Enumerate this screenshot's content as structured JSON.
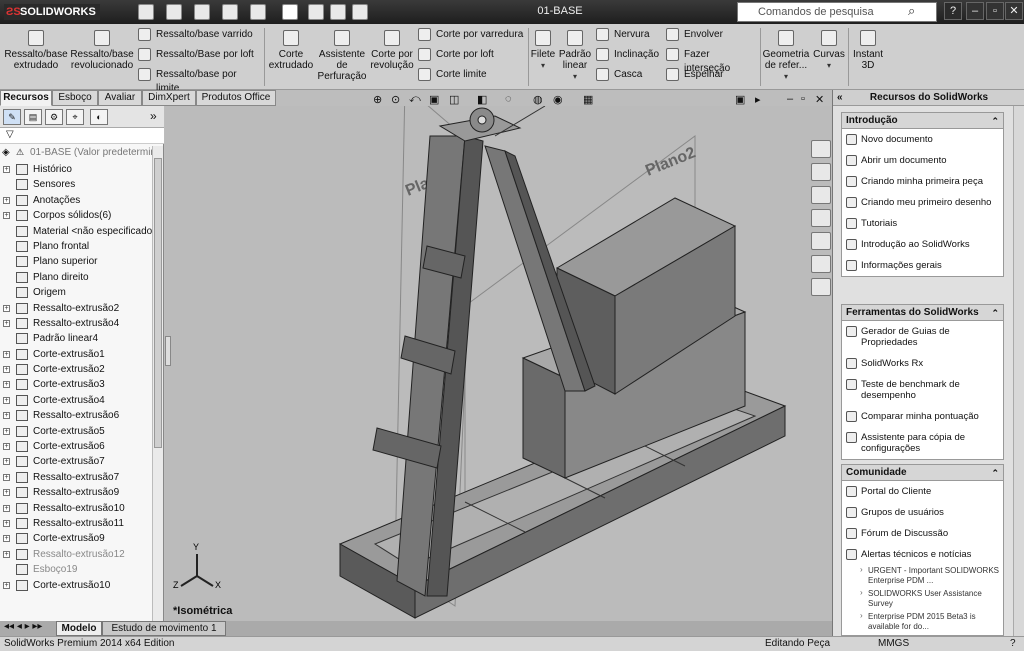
{
  "app": {
    "logo": "SOLIDWORKS",
    "doc_title": "01-BASE"
  },
  "search": {
    "placeholder": "Comandos de pesquisa"
  },
  "window": {
    "minimize": "–",
    "maximize": "▫",
    "close": "✕",
    "help": "?"
  },
  "ribbon": {
    "big": [
      {
        "label": "Ressalto/base extrudado"
      },
      {
        "label": "Ressalto/base revolucionado"
      },
      {
        "label": "Corte extrudado"
      },
      {
        "label": "Assistente de Perfuração"
      },
      {
        "label": "Corte por revolução"
      },
      {
        "label": "Filete"
      },
      {
        "label": "Padrão linear"
      },
      {
        "label": "Geometria de refer..."
      },
      {
        "label": "Curvas"
      },
      {
        "label": "Instant 3D"
      }
    ],
    "small": [
      {
        "label": "Ressalto/base varrido"
      },
      {
        "label": "Ressalto/Base por loft"
      },
      {
        "label": "Ressalto/base por limite"
      },
      {
        "label": "Corte por varredura"
      },
      {
        "label": "Corte por loft"
      },
      {
        "label": "Corte limite"
      },
      {
        "label": "Nervura"
      },
      {
        "label": "Inclinação"
      },
      {
        "label": "Casca"
      },
      {
        "label": "Envolver"
      },
      {
        "label": "Fazer interseção"
      },
      {
        "label": "Espelhar"
      }
    ]
  },
  "tabs": [
    "Recursos",
    "Esboço",
    "Avaliar",
    "DimXpert",
    "Produtos Office"
  ],
  "tree": {
    "root": "01-BASE  (Valor predetermin",
    "items": [
      {
        "label": "Histórico",
        "icon": "history-icon",
        "exp": true,
        "dim": false
      },
      {
        "label": "Sensores",
        "icon": "sensor-icon",
        "exp": false,
        "dim": false
      },
      {
        "label": "Anotações",
        "icon": "annotation-icon",
        "exp": true,
        "dim": false
      },
      {
        "label": "Corpos sólidos(6)",
        "icon": "solid-bodies-icon",
        "exp": true,
        "dim": false
      },
      {
        "label": "Material <não especificado>",
        "icon": "material-icon",
        "exp": false,
        "dim": false
      },
      {
        "label": "Plano frontal",
        "icon": "plane-icon",
        "exp": false,
        "dim": false
      },
      {
        "label": "Plano superior",
        "icon": "plane-icon",
        "exp": false,
        "dim": false
      },
      {
        "label": "Plano direito",
        "icon": "plane-icon",
        "exp": false,
        "dim": false
      },
      {
        "label": "Origem",
        "icon": "origin-icon",
        "exp": false,
        "dim": false
      },
      {
        "label": "Ressalto-extrusão2",
        "icon": "extrude-icon",
        "exp": true,
        "dim": false
      },
      {
        "label": "Ressalto-extrusão4",
        "icon": "extrude-icon",
        "exp": true,
        "dim": false
      },
      {
        "label": "Padrão linear4",
        "icon": "pattern-icon",
        "exp": false,
        "dim": false
      },
      {
        "label": "Corte-extrusão1",
        "icon": "cut-icon",
        "exp": true,
        "dim": false
      },
      {
        "label": "Corte-extrusão2",
        "icon": "cut-icon",
        "exp": true,
        "dim": false
      },
      {
        "label": "Corte-extrusão3",
        "icon": "cut-icon",
        "exp": true,
        "dim": false
      },
      {
        "label": "Corte-extrusão4",
        "icon": "cut-icon",
        "exp": true,
        "dim": false
      },
      {
        "label": "Ressalto-extrusão6",
        "icon": "extrude-icon",
        "exp": true,
        "dim": false
      },
      {
        "label": "Corte-extrusão5",
        "icon": "cut-icon",
        "exp": true,
        "dim": false
      },
      {
        "label": "Corte-extrusão6",
        "icon": "cut-icon",
        "exp": true,
        "dim": false
      },
      {
        "label": "Corte-extrusão7",
        "icon": "cut-icon",
        "exp": true,
        "dim": false
      },
      {
        "label": "Ressalto-extrusão7",
        "icon": "extrude-icon",
        "exp": true,
        "dim": false
      },
      {
        "label": "Ressalto-extrusão9",
        "icon": "extrude-icon",
        "exp": true,
        "dim": false
      },
      {
        "label": "Ressalto-extrusão10",
        "icon": "extrude-icon",
        "exp": true,
        "dim": false
      },
      {
        "label": "Ressalto-extrusão11",
        "icon": "extrude-icon",
        "exp": true,
        "dim": false
      },
      {
        "label": "Corte-extrusão9",
        "icon": "cut-icon",
        "exp": true,
        "dim": false
      },
      {
        "label": "Ressalto-extrusão12",
        "icon": "warning-icon",
        "exp": true,
        "dim": true
      },
      {
        "label": "Esboço19",
        "icon": "warning-icon",
        "exp": false,
        "dim": true
      },
      {
        "label": "Corte-extrusão10",
        "icon": "cut-icon",
        "exp": true,
        "dim": false
      }
    ]
  },
  "viewport": {
    "view_label": "*Isométrica",
    "plane1": "Plano1",
    "plane2": "Plano2",
    "axis_x": "X",
    "axis_y": "Y",
    "axis_z": "Z"
  },
  "taskpane": {
    "title": "Recursos do SolidWorks",
    "sections": [
      {
        "title": "Introdução",
        "items": [
          "Novo documento",
          "Abrir um documento",
          "Criando minha primeira peça",
          "Criando meu primeiro desenho",
          "Tutoriais",
          "Introdução ao SolidWorks",
          "Informações gerais"
        ]
      },
      {
        "title": "Ferramentas do SolidWorks",
        "items": [
          "Gerador de Guias de Propriedades",
          "SolidWorks Rx",
          "Teste de benchmark de desempenho",
          "Comparar minha pontuação",
          "Assistente para cópia de configurações"
        ]
      },
      {
        "title": "Comunidade",
        "items": [
          "Portal do Cliente",
          "Grupos de usuários",
          "Fórum de Discussão",
          "Alertas técnicos e notícias"
        ],
        "news": [
          "URGENT - Important SOLIDWORKS Enterprise PDM ...",
          "SOLIDWORKS User Assistance Survey",
          "Enterprise PDM 2015 Beta3 is available for do..."
        ]
      }
    ]
  },
  "bottom_tabs": [
    "Modelo",
    "Estudo de movimento 1"
  ],
  "status": {
    "left": "SolidWorks Premium 2014 x64 Edition",
    "mode": "Editando Peça",
    "units": "MMGS",
    "help": "?"
  }
}
